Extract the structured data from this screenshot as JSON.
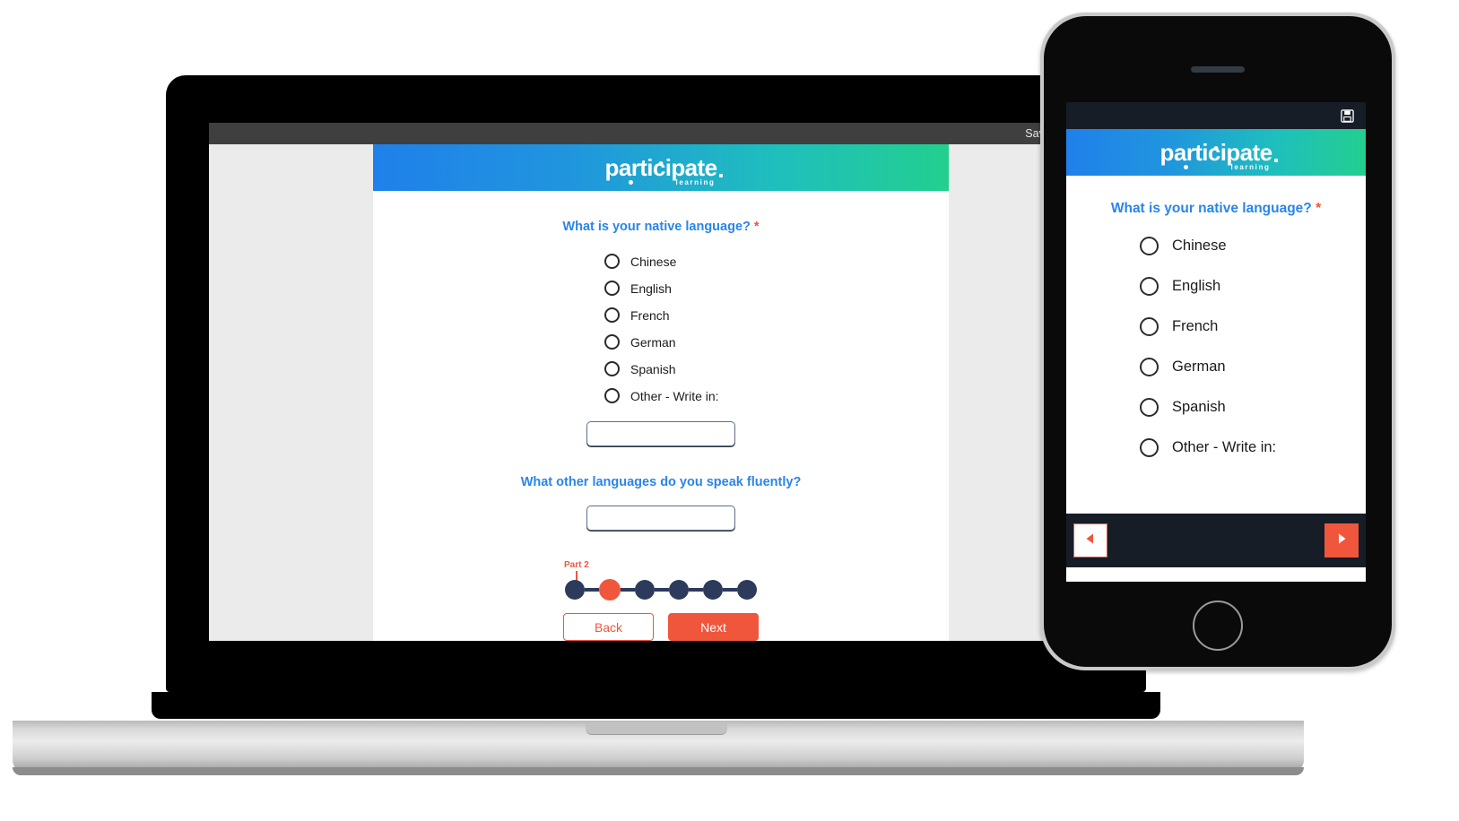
{
  "laptop": {
    "toolbar": {
      "save_label": "Save and conti"
    },
    "brand": {
      "name": "participate",
      "tagline": "learning"
    },
    "form": {
      "question1": "What is your native language?",
      "question1_required_marker": "*",
      "options": [
        "Chinese",
        "English",
        "French",
        "German",
        "Spanish",
        "Other - Write in:"
      ],
      "other_input_value": "",
      "other_input_placeholder": "",
      "question2": "What other languages do you speak fluently?",
      "question2_input_value": "",
      "question2_input_placeholder": "",
      "stepper": {
        "current_label": "Part 2",
        "total_steps": 6,
        "active_index": 1,
        "active_color": "#f0563c",
        "inactive_color": "#2c3a5c"
      },
      "back_button": "Back",
      "next_button": "Next"
    }
  },
  "phone": {
    "statusbar": {
      "save_icon": "save-disk-icon"
    },
    "brand": {
      "name": "participate",
      "tagline": "learning"
    },
    "form": {
      "question1": "What is your native language?",
      "question1_required_marker": "*",
      "options": [
        "Chinese",
        "English",
        "French",
        "German",
        "Spanish",
        "Other - Write in:"
      ]
    },
    "nav": {
      "prev_icon": "triangle-left-icon",
      "next_icon": "triangle-right-icon"
    }
  },
  "colors": {
    "brand_blue": "#2a85e8",
    "accent_orange": "#f0563c",
    "step_navy": "#2c3a5c",
    "gradient_start": "#1f80ea",
    "gradient_end": "#23cf8f"
  }
}
